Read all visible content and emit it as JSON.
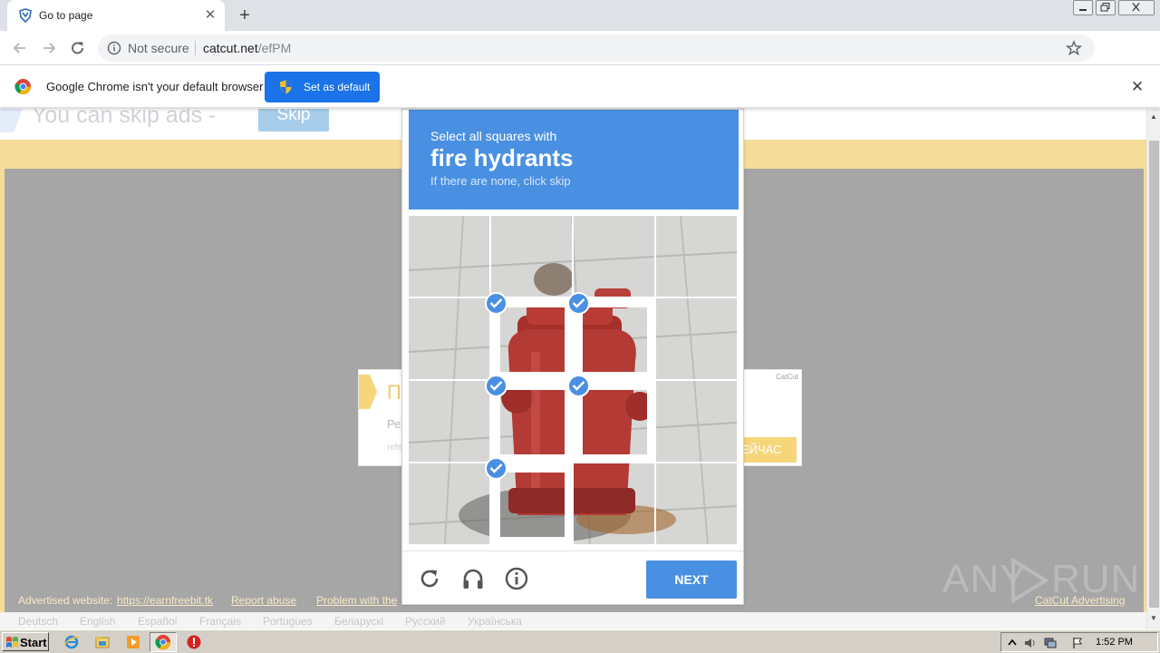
{
  "browser": {
    "tab": {
      "title": "Go to page",
      "close_label": "✕"
    },
    "new_tab_label": "+",
    "address": {
      "security": "Not secure",
      "host": "catcut.net",
      "path": "/efPM"
    },
    "infobar": {
      "message": "Google Chrome isn't your default browser",
      "button_label": "Set as default",
      "close_label": "✕"
    }
  },
  "page": {
    "skip_text": "You can skip ads  -",
    "skip_button": "Skip",
    "ad_card": {
      "heading": "П",
      "body": "Ре",
      "footnote": "refe",
      "brand": "CatCut",
      "cta": "ЕЙЧАС"
    },
    "footer": {
      "advertised_label": "Advertised website:",
      "advertised_link": "https://earnfreebit.tk",
      "report": "Report abuse",
      "problem": "Problem with the",
      "brand_link": "CatCut Advertising"
    },
    "languages": [
      "Deutsch",
      "English",
      "Español",
      "Français",
      "Portugues",
      "Беларускі",
      "Русский",
      "Українська"
    ]
  },
  "captcha": {
    "instruction_line": "Select all squares with",
    "target": "fire hydrants",
    "hint": "If there are none, click skip",
    "grid_rows": 4,
    "grid_cols": 4,
    "selected_tiles": [
      5,
      6,
      9,
      10,
      13
    ],
    "next_label": "NEXT",
    "icons": [
      "reload-icon",
      "audio-icon",
      "info-icon"
    ]
  },
  "watermark": {
    "left": "ANY",
    "right": "RUN"
  },
  "taskbar": {
    "start_label": "Start",
    "clock": "1:52 PM"
  },
  "colors": {
    "captcha_blue": "#4a90e2",
    "chrome_blue": "#1a73e8",
    "page_yellow": "#f5dc98",
    "panel_gray": "#a6a6a6",
    "hydrant_red": "#b03a36"
  }
}
